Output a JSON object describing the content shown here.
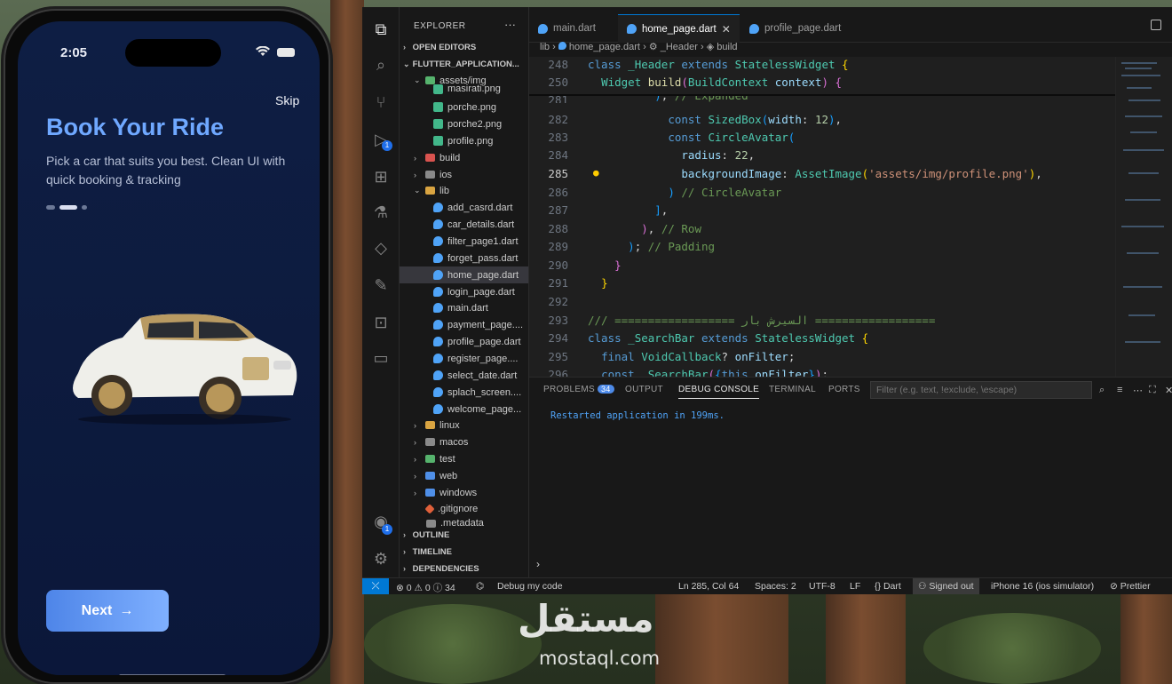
{
  "phone": {
    "time": "2:05",
    "skip": "Skip",
    "title": "Book Your Ride",
    "subtitle": "Pick a car that suits you best. Clean UI with quick booking & tracking",
    "next_label": "Next",
    "pages_total": 3,
    "current_page": 2
  },
  "explorer": {
    "header": "EXPLORER",
    "open_editors": "OPEN EDITORS",
    "project": "FLUTTER_APPLICATION...",
    "assets_folder": "assets/img",
    "files": {
      "masirati": "masirati.png",
      "porche": "porche.png",
      "porche2": "porche2.png",
      "profile": "profile.png",
      "build": "build",
      "ios": "ios",
      "lib": "lib",
      "add_card": "add_casrd.dart",
      "car_details": "car_details.dart",
      "filter_page": "filter_page1.dart",
      "forget_pass": "forget_pass.dart",
      "home_page": "home_page.dart",
      "login_page": "login_page.dart",
      "main": "main.dart",
      "payment_page": "payment_page....",
      "profile_page": "profile_page.dart",
      "register_page": "register_page....",
      "select_date": "select_date.dart",
      "splach_screen": "splach_screen....",
      "welcome_page": "welcome_page...",
      "linux": "linux",
      "macos": "macos",
      "test": "test",
      "web": "web",
      "windows": "windows",
      "gitignore": ".gitignore",
      "metadata": ".metadata"
    },
    "outline": "OUTLINE",
    "timeline": "TIMELINE",
    "dependencies": "DEPENDENCIES"
  },
  "tabs": {
    "main": "main.dart",
    "home": "home_page.dart",
    "profile": "profile_page.dart"
  },
  "breadcrumbs": {
    "lib": "lib",
    "file": "home_page.dart",
    "class": "_Header",
    "method": "build"
  },
  "activity_badges": {
    "run": "1",
    "accounts": "1"
  },
  "editor": {
    "sticky": [
      {
        "ln": "248",
        "text": "class _Header extends StatelessWidget {"
      },
      {
        "ln": "250",
        "text": "  Widget build(BuildContext context) {"
      }
    ],
    "lines": [
      {
        "ln": "281",
        "text": "            ), // Expanded"
      },
      {
        "ln": "282",
        "text": "            const SizedBox(width: 12),"
      },
      {
        "ln": "283",
        "text": "            const CircleAvatar("
      },
      {
        "ln": "284",
        "text": "              radius: 22,"
      },
      {
        "ln": "285",
        "text": "              backgroundImage: AssetImage('assets/img/profile.png'),"
      },
      {
        "ln": "286",
        "text": "            ) // CircleAvatar"
      },
      {
        "ln": "287",
        "text": "          ],"
      },
      {
        "ln": "288",
        "text": "        ), // Row"
      },
      {
        "ln": "289",
        "text": "      ); // Padding"
      },
      {
        "ln": "290",
        "text": "    }"
      },
      {
        "ln": "291",
        "text": "  }"
      },
      {
        "ln": "292",
        "text": ""
      },
      {
        "ln": "293",
        "text": "/// ================== السيرش بار =================="
      },
      {
        "ln": "294",
        "text": "class _SearchBar extends StatelessWidget {"
      },
      {
        "ln": "295",
        "text": "  final VoidCallback? onFilter;"
      },
      {
        "ln": "296",
        "text": "  const _SearchBar({this.onFilter});"
      }
    ],
    "current_line": "285"
  },
  "panel": {
    "problems": "PROBLEMS",
    "problems_count": "34",
    "output": "OUTPUT",
    "debug_console": "DEBUG CONSOLE",
    "terminal": "TERMINAL",
    "ports": "PORTS",
    "filter_placeholder": "Filter (e.g. text, !exclude, \\escape)",
    "console_message": "Restarted application in 199ms."
  },
  "status": {
    "errors": "0",
    "warnings": "0",
    "infos": "34",
    "debug": "Debug my code",
    "position": "Ln 285, Col 64",
    "spaces": "Spaces: 2",
    "encoding": "UTF-8",
    "eol": "LF",
    "language": "Dart",
    "signed": "Signed out",
    "device": "iPhone 16 (ios simulator)",
    "prettier": "Prettier"
  },
  "watermark": {
    "arabic": "مستقل",
    "latin": "mostaql.com"
  }
}
